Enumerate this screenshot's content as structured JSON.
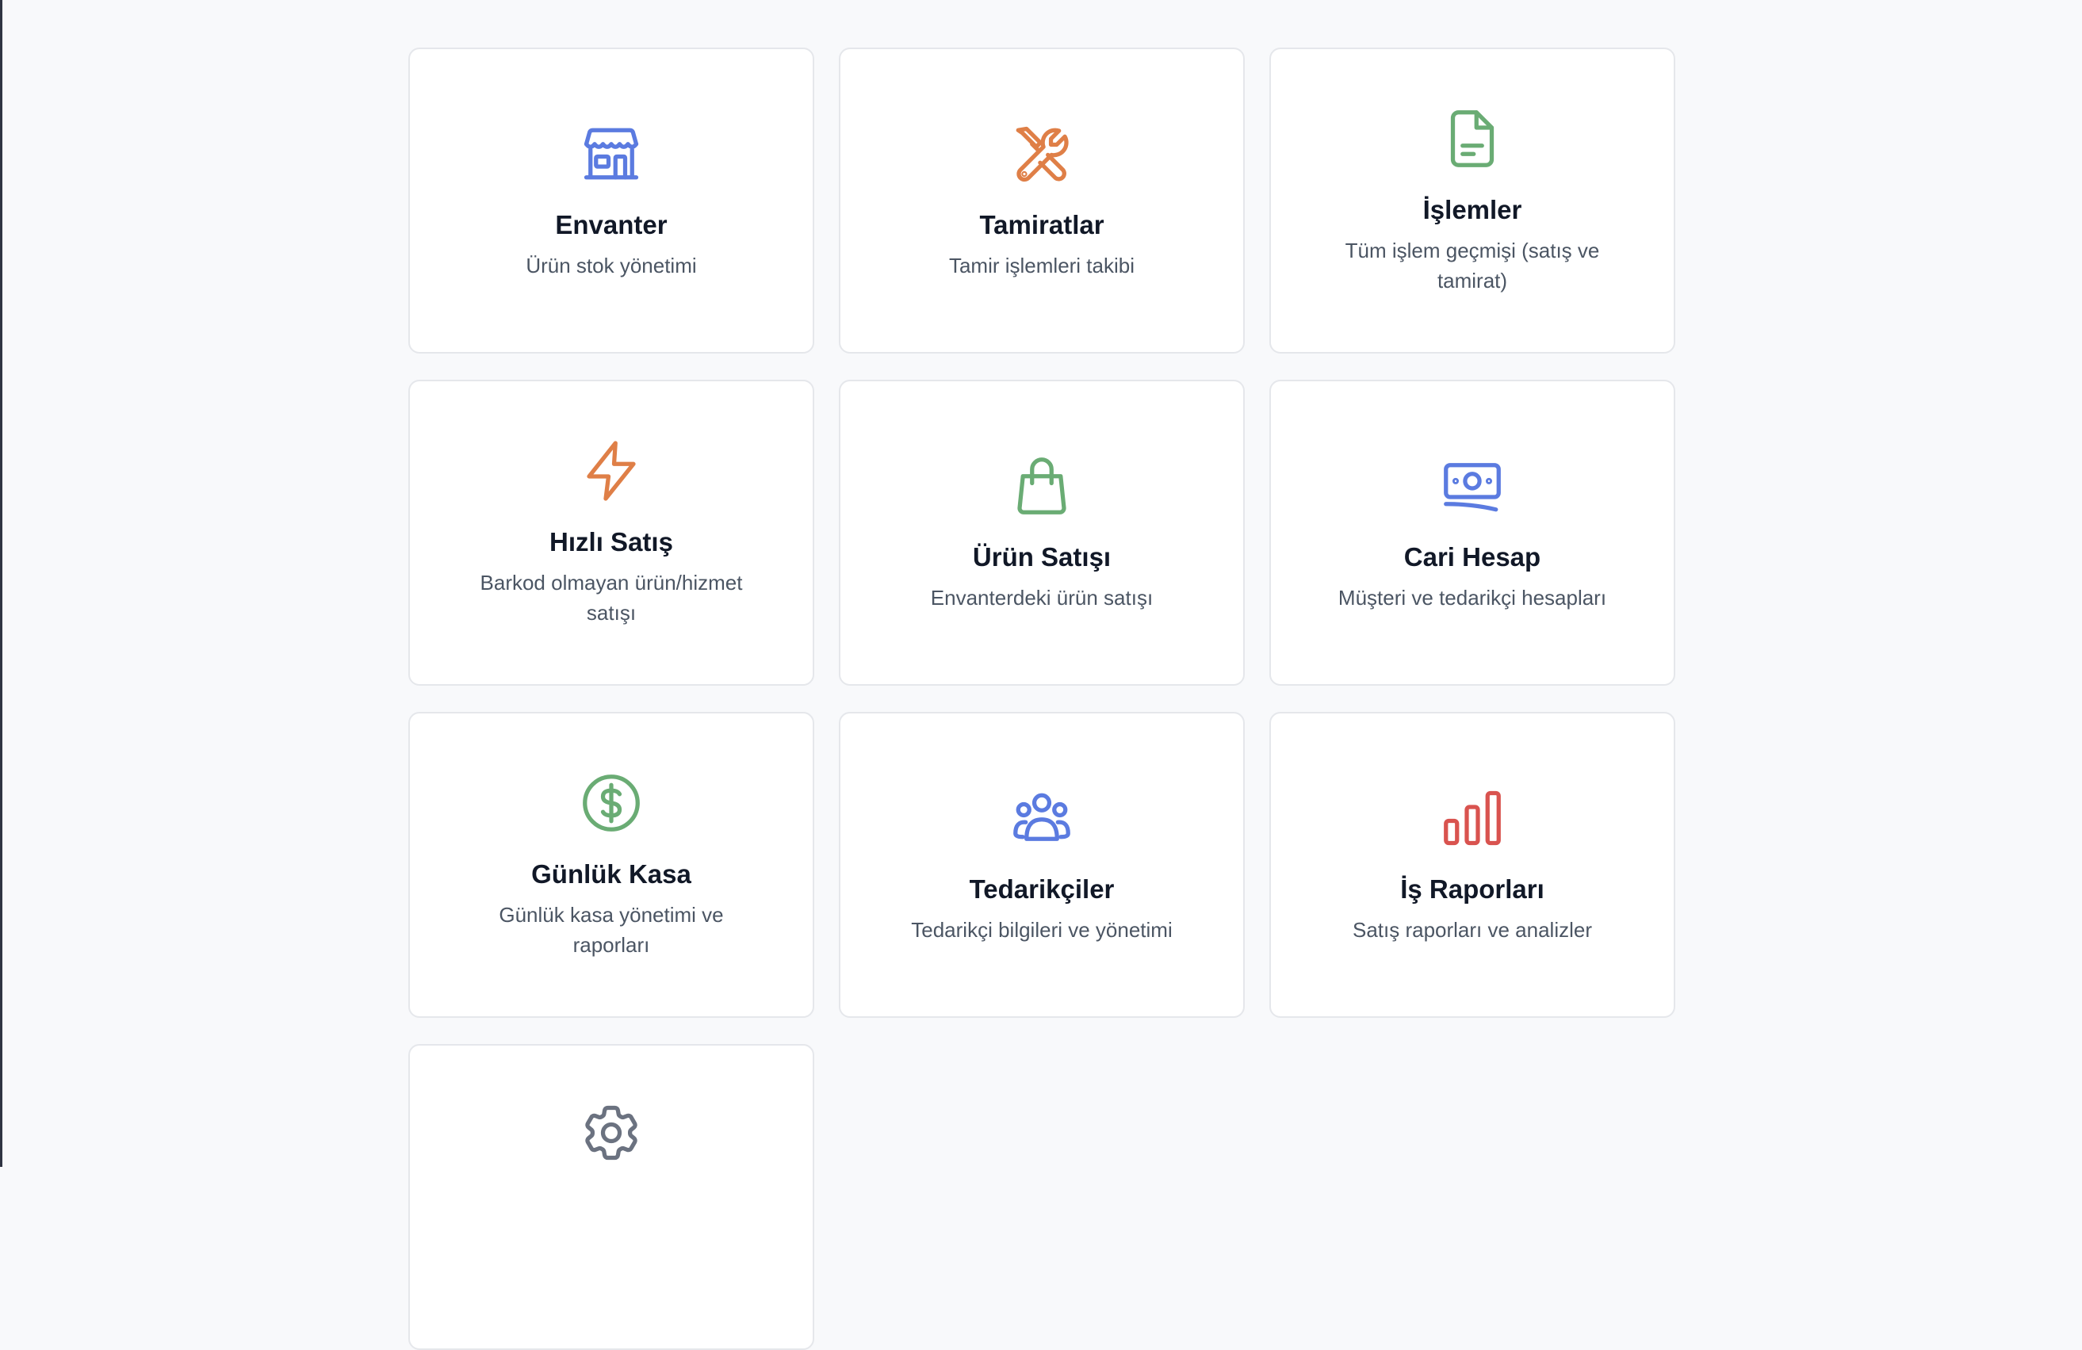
{
  "colors": {
    "blue": "#5b7be0",
    "orange": "#df7f47",
    "green": "#6aac74",
    "red": "#d9534f",
    "gray": "#6b7280"
  },
  "cards": [
    {
      "title": "Envanter",
      "desc": "Ürün stok yönetimi",
      "icon": "storefront-icon"
    },
    {
      "title": "Tamiratlar",
      "desc": "Tamir işlemleri takibi",
      "icon": "wrench-screwdriver-icon"
    },
    {
      "title": "İşlemler",
      "desc": "Tüm işlem geçmişi (satış ve tamirat)",
      "icon": "document-icon"
    },
    {
      "title": "Hızlı Satış",
      "desc": "Barkod olmayan ürün/hizmet satışı",
      "icon": "lightning-bolt-icon"
    },
    {
      "title": "Ürün Satışı",
      "desc": "Envanterdeki ürün satışı",
      "icon": "shopping-bag-icon"
    },
    {
      "title": "Cari Hesap",
      "desc": "Müşteri ve tedarikçi hesapları",
      "icon": "banknotes-icon"
    },
    {
      "title": "Günlük Kasa",
      "desc": "Günlük kasa yönetimi ve raporları",
      "icon": "dollar-circle-icon"
    },
    {
      "title": "Tedarikçiler",
      "desc": "Tedarikçi bilgileri ve yönetimi",
      "icon": "user-group-icon"
    },
    {
      "title": "İş Raporları",
      "desc": "Satış raporları ve analizler",
      "icon": "bar-chart-icon"
    },
    {
      "title": "",
      "desc": "",
      "icon": "gear-icon"
    }
  ]
}
